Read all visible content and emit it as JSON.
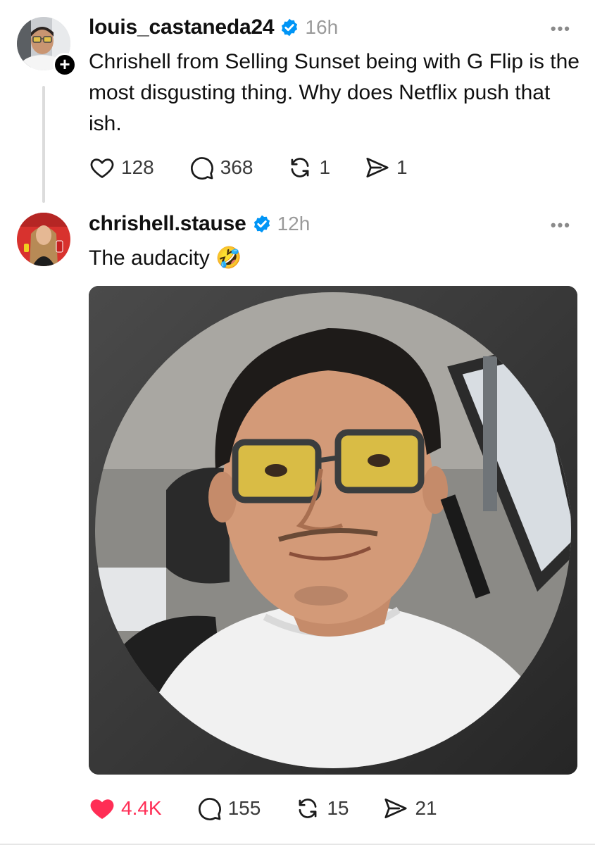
{
  "posts": [
    {
      "username": "louis_castaneda24",
      "timestamp": "16h",
      "text": "Chrishell from Selling Sunset being with G Flip is the most disgusting thing. Why does Netflix push that ish.",
      "avatar": "avatar-man-glasses",
      "verified": true,
      "follow_badge": "+",
      "more_label": "•••",
      "actions": {
        "likes": "128",
        "replies": "368",
        "reposts": "1",
        "shares": "1"
      },
      "liked": false
    },
    {
      "username": "chrishell.stause",
      "timestamp": "12h",
      "text": "The audacity 🤣",
      "avatar": "avatar-woman-red-carpet",
      "verified": true,
      "more_label": "•••",
      "image": "selfie-man-yellow-glasses-in-car-circle-crop",
      "actions": {
        "likes": "4.4K",
        "replies": "155",
        "reposts": "15",
        "shares": "21"
      },
      "liked": true
    }
  ],
  "colors": {
    "verified_blue": "#0095f6",
    "like_red": "#ff2d55",
    "muted_gray": "#9a9a9a",
    "thread_line": "#dcdcdc"
  }
}
